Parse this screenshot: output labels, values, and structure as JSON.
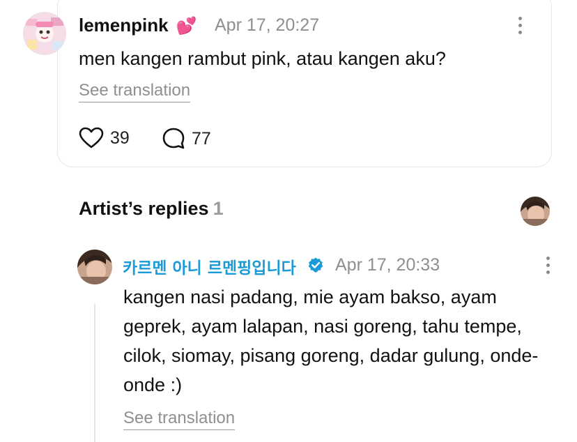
{
  "comment": {
    "author": "lemenpink",
    "author_emoji": "💕",
    "time": "Apr 17, 20:27",
    "text": "men kangen rambut pink, atau kangen aku?",
    "see_translation": "See translation",
    "likes": "39",
    "replies": "77",
    "icons": {
      "like": "heart-outline-icon",
      "reply": "speech-bubble-icon",
      "more": "more-vertical-icon"
    }
  },
  "artist_replies": {
    "title": "Artist’s replies",
    "count": "1"
  },
  "reply": {
    "author": "카르멘 아니 르멘핑입니다",
    "verified": true,
    "time": "Apr 17, 20:33",
    "text": "kangen nasi padang, mie ayam bakso, ayam geprek, ayam lalapan, nasi goreng, tahu tempe, cilok, siomay, pisang goreng, dadar gulung, onde-onde :)",
    "see_translation": "See translation"
  },
  "colors": {
    "accent": "#1a9ad6",
    "muted": "#8e8e93",
    "border": "#e6e6e6"
  }
}
